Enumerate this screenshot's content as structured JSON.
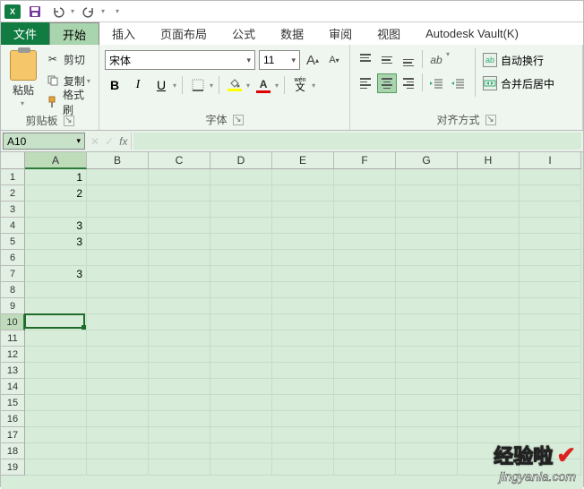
{
  "app_icon_text": "X",
  "tabs": {
    "file": "文件",
    "home": "开始",
    "insert": "插入",
    "page_layout": "页面布局",
    "formulas": "公式",
    "data": "数据",
    "review": "审阅",
    "view": "视图",
    "autodesk": "Autodesk Vault(K)"
  },
  "ribbon": {
    "clipboard": {
      "paste": "粘贴",
      "cut": "剪切",
      "copy": "复制",
      "formatpainter": "格式刷",
      "label": "剪贴板"
    },
    "font": {
      "name": "宋体",
      "size": "11",
      "increase_label": "A",
      "decrease_label": "A",
      "bold": "B",
      "italic": "I",
      "underline": "U",
      "phonetic": "wén",
      "label": "字体"
    },
    "alignment": {
      "wrap": "自动换行",
      "merge": "合并后居中",
      "label": "对齐方式"
    }
  },
  "name_box": "A10",
  "fx_label": "fx",
  "columns": [
    "A",
    "B",
    "C",
    "D",
    "E",
    "F",
    "G",
    "H",
    "I"
  ],
  "selected_column_index": 0,
  "row_count": 19,
  "selected_row": 10,
  "cell_data": {
    "A1": "1",
    "A2": "2",
    "A4": "3",
    "A5": "3",
    "A7": "3"
  },
  "active_cell": {
    "col": 0,
    "row": 10
  },
  "watermark": {
    "line1": "经验啦",
    "line2": "jingyanla.com"
  }
}
